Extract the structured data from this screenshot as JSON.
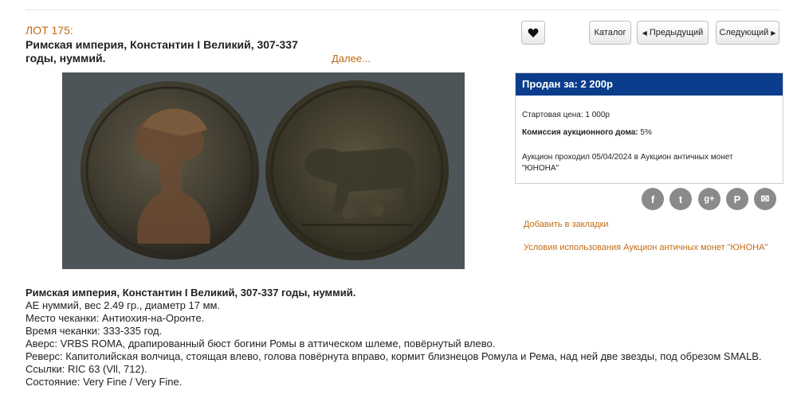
{
  "lot_label": "ЛОТ 175:",
  "title_line1": "Римская империя, Константин I Великий, 307-337",
  "title_line2": "годы, нуммий.",
  "more_link": "Далее...",
  "buttons": {
    "favorite_icon": "heart-icon",
    "catalog": "Каталог",
    "prev": "Предыдущий",
    "next": "Следующий"
  },
  "price": {
    "sold_for": "Продан за: 2 200р",
    "start_label": "Стартовая цена:",
    "start_value": "1 000р",
    "commission_label": "Комиссия аукционного дома:",
    "commission_value": "5%",
    "auction_line1": "Аукцион проходил 05/04/2024 в Аукцион античных монет",
    "auction_line2": "\"ЮНОНА\""
  },
  "social": [
    {
      "name": "facebook-icon",
      "glyph": "f"
    },
    {
      "name": "twitter-icon",
      "glyph": "t"
    },
    {
      "name": "googleplus-icon",
      "glyph": "g+"
    },
    {
      "name": "pinterest-icon",
      "glyph": "P"
    },
    {
      "name": "email-icon",
      "glyph": "✉"
    }
  ],
  "links": {
    "bookmark": "Добавить в закладки",
    "terms": "Условия использования Аукцион античных монет \"ЮНОНА\""
  },
  "description": {
    "heading": "Римская империя, Константин I Великий, 307-337 годы, нуммий.",
    "lines": [
      "AE нуммий, вес 2.49 гр., диаметр 17 мм.",
      "Место чеканки: Антиохия-на-Оронте.",
      "Время чеканки: 333-335 год.",
      "Аверс: VRBS ROMA, драпированный бюст богини Ромы в аттическом шлеме, повёрнутый влево.",
      "Реверс: Капитолийская волчица, стоящая влево, голова повёрнута вправо, кормит близнецов Ромула и Рема, над ней две звезды, под обрезом SMALB.",
      "Ссылки: RIC 63 (Vll, 712).",
      "Состояние: Very Fine / Very Fine."
    ]
  }
}
